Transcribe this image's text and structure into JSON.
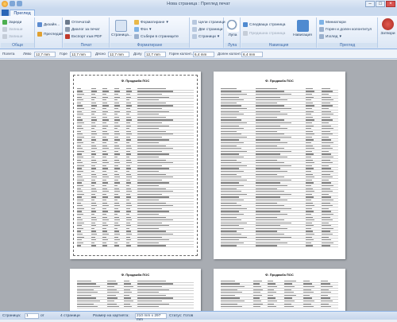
{
  "window": {
    "title": "Нова страница : Преглед печат"
  },
  "tabs": {
    "active": "Преглед"
  },
  "ribbon": {
    "groups": {
      "common": "Общи",
      "print": "Печат",
      "formatting": "Форматиране",
      "zoom": "Лупа",
      "navigation": "Навигация",
      "view": "Преглед"
    },
    "common": {
      "charge": "Зареди",
      "record": "Запиши",
      "save": "Запиши"
    },
    "design": "Дизайн...",
    "preview": "Прегледай",
    "print": {
      "print": "Отпечатай",
      "dialog": "Диалог за печат",
      "export": "Експорт към PDF"
    },
    "page": "Страница...",
    "format": {
      "formatting": "Форматиране",
      "background": "Фон",
      "collect": "Събери в страниците"
    },
    "zoom": {
      "whole": "Цели страници",
      "two": "Две страници",
      "pages": "Страници"
    },
    "lupa": "Лупа",
    "nav": {
      "next": "Следваща страница",
      "prev": "Предишна страница",
      "navigate": "Навигация"
    },
    "view": {
      "thumbs": "Миниатюри",
      "header": "Горен и долен колонтитул",
      "view": "Изглед"
    },
    "close": "Затвори"
  },
  "margins": {
    "paper_label": "Полета",
    "left_label": "Ляво",
    "left": "12,7 mm",
    "top_label": "Горе",
    "top": "12,7 mm",
    "right_label": "Дясно",
    "right": "12,7 mm",
    "bottom_label": "Долу",
    "bottom": "12,7 mm",
    "header_label": "Горен колонт...",
    "header": "6,4 mm",
    "footer_label": "Долен колонт...",
    "footer": "6,4 mm"
  },
  "pages": {
    "title1": "Ф. Продажба ПОС",
    "title2": "Ф. Продажба ПОС",
    "title3": "Ф. Продажба ПОС",
    "title4": "Ф. Продажба ПОС"
  },
  "status": {
    "page_label": "Страница:",
    "page": "1",
    "of": "от",
    "of_total": "4 страници",
    "paper_label": "Размер на хартията:",
    "paper": "210 mm x 297 mm",
    "status_label": "Статус:",
    "status": "Готов"
  }
}
